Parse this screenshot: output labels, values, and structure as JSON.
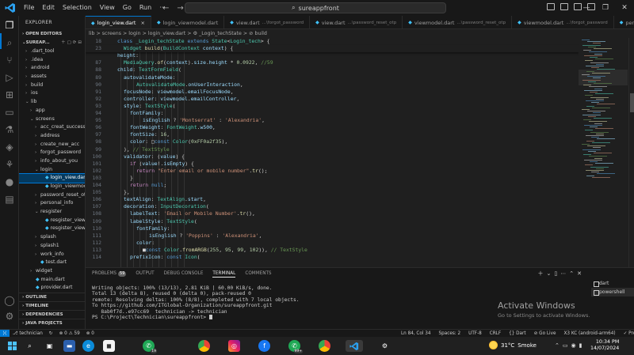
{
  "titlebar": {
    "menu": [
      "File",
      "Edit",
      "Selection",
      "View",
      "Go",
      "Run",
      "···"
    ],
    "search_text": "sureappfront"
  },
  "sidebar": {
    "title": "EXPLORER",
    "open_editors": "OPEN EDITORS",
    "project": "SUREAP...",
    "tree": [
      {
        "label": ".dart_tool",
        "level": 1,
        "chevron": "›"
      },
      {
        "label": ".idea",
        "level": 1,
        "chevron": "›"
      },
      {
        "label": "android",
        "level": 1,
        "chevron": "›"
      },
      {
        "label": "assets",
        "level": 1,
        "chevron": "›"
      },
      {
        "label": "build",
        "level": 1,
        "chevron": "›"
      },
      {
        "label": "ios",
        "level": 1,
        "chevron": "›"
      },
      {
        "label": "lib",
        "level": 1,
        "chevron": "⌄"
      },
      {
        "label": "app",
        "level": 2,
        "chevron": "›"
      },
      {
        "label": "screens",
        "level": 2,
        "chevron": "⌄"
      },
      {
        "label": "acc_creat_successf...",
        "level": 3,
        "chevron": "›"
      },
      {
        "label": "address",
        "level": 3,
        "chevron": "›"
      },
      {
        "label": "create_new_acc",
        "level": 3,
        "chevron": "›"
      },
      {
        "label": "forgot_password",
        "level": 3,
        "chevron": "›"
      },
      {
        "label": "info_about_you",
        "level": 3,
        "chevron": "›"
      },
      {
        "label": "login",
        "level": 3,
        "chevron": "⌄"
      },
      {
        "label": "login_view.dart",
        "level": 4,
        "chevron": "",
        "dart": true,
        "selected": true
      },
      {
        "label": "login_viewmodel....",
        "level": 4,
        "chevron": "",
        "dart": true
      },
      {
        "label": "password_reset_otp",
        "level": 3,
        "chevron": "›"
      },
      {
        "label": "personal_info",
        "level": 3,
        "chevron": "›"
      },
      {
        "label": "resgister",
        "level": 3,
        "chevron": "⌄"
      },
      {
        "label": "resgister_view.dart",
        "level": 4,
        "chevron": "",
        "dart": true
      },
      {
        "label": "resgister_viewmo...",
        "level": 4,
        "chevron": "",
        "dart": true
      },
      {
        "label": "splash",
        "level": 3,
        "chevron": "›"
      },
      {
        "label": "splash1",
        "level": 3,
        "chevron": "›"
      },
      {
        "label": "work_info",
        "level": 3,
        "chevron": "›"
      },
      {
        "label": "test.dart",
        "level": 3,
        "chevron": "",
        "dart": true
      },
      {
        "label": "widget",
        "level": 2,
        "chevron": "›"
      },
      {
        "label": "main.dart",
        "level": 2,
        "chevron": "",
        "dart": true
      },
      {
        "label": "provider.dart",
        "level": 2,
        "chevron": "",
        "dart": true
      }
    ],
    "outline": "OUTLINE",
    "timeline": "TIMELINE",
    "dependencies": "DEPENDENCIES",
    "java_projects": "JAVA PROJECTS"
  },
  "tabs": [
    {
      "label": "login_view.dart",
      "desc": "",
      "active": true
    },
    {
      "label": "login_viewmodel.dart",
      "desc": ""
    },
    {
      "label": "view.dart",
      "desc": "...\\forgot_password"
    },
    {
      "label": "view.dart",
      "desc": "...\\password_reset_otp"
    },
    {
      "label": "viewmodel.dart",
      "desc": "...\\password_reset_otp"
    },
    {
      "label": "viewmodel.dart",
      "desc": "...\\forgot_password"
    },
    {
      "label": "per",
      "desc": ""
    }
  ],
  "breadcrumb": "lib > screens > login > login_view.dart > ⚙ _Login_techState > ⊘ build",
  "code": {
    "sticky": [
      {
        "n": "18",
        "t": [
          [
            "c-kw",
            "class "
          ],
          [
            "c-ty",
            "_Login_techState "
          ],
          [
            "c-kw",
            "extends "
          ],
          [
            "c-ty",
            "State"
          ],
          [
            "c-pl",
            "<"
          ],
          [
            "c-ty",
            "Login_tech"
          ],
          [
            "c-pl",
            "> {"
          ]
        ]
      },
      {
        "n": "23",
        "t": [
          [
            "c-pl",
            "  "
          ],
          [
            "c-ty",
            "Widget "
          ],
          [
            "c-fn",
            "build"
          ],
          [
            "c-pl",
            "("
          ],
          [
            "c-ty",
            "BuildContext "
          ],
          [
            "c-pr",
            "context"
          ],
          [
            "c-pl",
            ") {"
          ]
        ]
      }
    ],
    "lines": [
      {
        "n": "",
        "i": 24,
        "t": [
          [
            "c-pr",
            "height"
          ],
          [
            "c-pl",
            ":"
          ]
        ]
      },
      {
        "n": "87",
        "i": 26,
        "t": [
          [
            "c-ty",
            "MediaQuery"
          ],
          [
            "c-pl",
            "."
          ],
          [
            "c-fn",
            "of"
          ],
          [
            "c-pl",
            "("
          ],
          [
            "c-pr",
            "context"
          ],
          [
            "c-pl",
            ")."
          ],
          [
            "c-pr",
            "size"
          ],
          [
            "c-pl",
            "."
          ],
          [
            "c-pr",
            "height "
          ],
          [
            "c-pl",
            "* "
          ],
          [
            "c-nm",
            "0.0922"
          ],
          [
            "c-pl",
            ", "
          ],
          [
            "c-cm",
            "//59"
          ]
        ]
      },
      {
        "n": "88",
        "i": 24,
        "t": [
          [
            "c-pr",
            "child"
          ],
          [
            "c-pl",
            ": "
          ],
          [
            "c-ty",
            "TextFormField"
          ],
          [
            "c-pl",
            "("
          ]
        ]
      },
      {
        "n": "89",
        "i": 26,
        "t": [
          [
            "c-pr",
            "autovalidateMode"
          ],
          [
            "c-pl",
            ":"
          ]
        ]
      },
      {
        "n": "90",
        "i": 30,
        "t": [
          [
            "c-ty",
            "AutovalidateMode"
          ],
          [
            "c-pl",
            "."
          ],
          [
            "c-pr",
            "onUserInteraction"
          ],
          [
            "c-pl",
            ","
          ]
        ]
      },
      {
        "n": "91",
        "i": 26,
        "t": [
          [
            "c-pr",
            "focusNode"
          ],
          [
            "c-pl",
            ": "
          ],
          [
            "c-pr",
            "viewmodel"
          ],
          [
            "c-pl",
            "."
          ],
          [
            "c-pr",
            "emailFocusNode"
          ],
          [
            "c-pl",
            ","
          ]
        ]
      },
      {
        "n": "92",
        "i": 26,
        "t": [
          [
            "c-pr",
            "controller"
          ],
          [
            "c-pl",
            ": "
          ],
          [
            "c-pr",
            "viewmodel"
          ],
          [
            "c-pl",
            "."
          ],
          [
            "c-pr",
            "emailController"
          ],
          [
            "c-pl",
            ","
          ]
        ]
      },
      {
        "n": "93",
        "i": 26,
        "t": [
          [
            "c-pr",
            "style"
          ],
          [
            "c-pl",
            ": "
          ],
          [
            "c-ty",
            "TextStyle"
          ],
          [
            "c-pl",
            "("
          ]
        ]
      },
      {
        "n": "94",
        "i": 28,
        "t": [
          [
            "c-pr",
            "fontFamily"
          ],
          [
            "c-pl",
            ":"
          ]
        ]
      },
      {
        "n": "95",
        "i": 32,
        "t": [
          [
            "c-pr",
            "isEnglish "
          ],
          [
            "c-pl",
            "? "
          ],
          [
            "c-st",
            "'Montserrat' "
          ],
          [
            "c-pl",
            ": "
          ],
          [
            "c-st",
            "'Alexandria'"
          ],
          [
            "c-pl",
            ","
          ]
        ]
      },
      {
        "n": "96",
        "i": 28,
        "t": [
          [
            "c-pr",
            "fontWeight"
          ],
          [
            "c-pl",
            ": "
          ],
          [
            "c-ty",
            "FontWeight"
          ],
          [
            "c-pl",
            "."
          ],
          [
            "c-pr",
            "w500"
          ],
          [
            "c-pl",
            ","
          ]
        ]
      },
      {
        "n": "97",
        "i": 28,
        "t": [
          [
            "c-pr",
            "fontSize"
          ],
          [
            "c-pl",
            ": "
          ],
          [
            "c-nm",
            "16"
          ],
          [
            "c-pl",
            ","
          ]
        ]
      },
      {
        "n": "98",
        "i": 28,
        "t": [
          [
            "c-pr",
            "color"
          ],
          [
            "c-pl",
            ": □"
          ],
          [
            "c-kw",
            "const "
          ],
          [
            "c-ty",
            "Color"
          ],
          [
            "c-pl",
            "("
          ],
          [
            "c-nm",
            "0xFF0a2f35"
          ],
          [
            "c-pl",
            "),"
          ]
        ]
      },
      {
        "n": "99",
        "i": 26,
        "t": [
          [
            "c-pl",
            "), "
          ],
          [
            "c-cm",
            "// TextStyle"
          ]
        ]
      },
      {
        "n": "100",
        "i": 26,
        "t": [
          [
            "c-pr",
            "validator"
          ],
          [
            "c-pl",
            ": ("
          ],
          [
            "c-pr",
            "value"
          ],
          [
            "c-pl",
            ") {"
          ]
        ]
      },
      {
        "n": "101",
        "i": 28,
        "t": [
          [
            "c-ctl",
            "if "
          ],
          [
            "c-pl",
            "("
          ],
          [
            "c-pr",
            "value"
          ],
          [
            "c-pl",
            "!."
          ],
          [
            "c-pr",
            "isEmpty"
          ],
          [
            "c-pl",
            ") {"
          ]
        ]
      },
      {
        "n": "102",
        "i": 30,
        "t": [
          [
            "c-ctl",
            "return "
          ],
          [
            "c-st",
            "\"Enter email or mobile number\""
          ],
          [
            "c-pl",
            "."
          ],
          [
            "c-fn",
            "tr"
          ],
          [
            "c-pl",
            "();"
          ]
        ]
      },
      {
        "n": "103",
        "i": 28,
        "t": [
          [
            "c-pl",
            "}"
          ]
        ]
      },
      {
        "n": "104",
        "i": 28,
        "t": [
          [
            "c-ctl",
            "return "
          ],
          [
            "c-kw",
            "null"
          ],
          [
            "c-pl",
            ";"
          ]
        ]
      },
      {
        "n": "105",
        "i": 26,
        "t": [
          [
            "c-pl",
            "},"
          ]
        ]
      },
      {
        "n": "106",
        "i": 26,
        "t": [
          [
            "c-pr",
            "textAlign"
          ],
          [
            "c-pl",
            ": "
          ],
          [
            "c-ty",
            "TextAlign"
          ],
          [
            "c-pl",
            "."
          ],
          [
            "c-pr",
            "start"
          ],
          [
            "c-pl",
            ","
          ]
        ]
      },
      {
        "n": "107",
        "i": 26,
        "t": [
          [
            "c-pr",
            "decoration"
          ],
          [
            "c-pl",
            ": "
          ],
          [
            "c-ty",
            "InputDecoration"
          ],
          [
            "c-pl",
            "("
          ]
        ]
      },
      {
        "n": "108",
        "i": 28,
        "t": [
          [
            "c-pr",
            "labelText"
          ],
          [
            "c-pl",
            ": "
          ],
          [
            "c-st",
            "'Email or Mobile Number'"
          ],
          [
            "c-pl",
            "."
          ],
          [
            "c-fn",
            "tr"
          ],
          [
            "c-pl",
            "(),"
          ]
        ]
      },
      {
        "n": "109",
        "i": 28,
        "t": [
          [
            "c-pr",
            "labelStyle"
          ],
          [
            "c-pl",
            ": "
          ],
          [
            "c-ty",
            "TextStyle"
          ],
          [
            "c-pl",
            "("
          ]
        ]
      },
      {
        "n": "110",
        "i": 30,
        "t": [
          [
            "c-pr",
            "fontFamily"
          ],
          [
            "c-pl",
            ":"
          ]
        ]
      },
      {
        "n": "111",
        "i": 34,
        "t": [
          [
            "c-pr",
            "isEnglish "
          ],
          [
            "c-pl",
            "? "
          ],
          [
            "c-st",
            "'Poppins' "
          ],
          [
            "c-pl",
            ": "
          ],
          [
            "c-st",
            "'Alexandria'"
          ],
          [
            "c-pl",
            ","
          ]
        ]
      },
      {
        "n": "112",
        "i": 30,
        "t": [
          [
            "c-pr",
            "color"
          ],
          [
            "c-pl",
            ":"
          ]
        ]
      },
      {
        "n": "113",
        "i": 32,
        "t": [
          [
            "c-pl",
            "■"
          ],
          [
            "c-kw",
            "const "
          ],
          [
            "c-ty",
            "Color"
          ],
          [
            "c-pl",
            "."
          ],
          [
            "c-fn",
            "fromARGB"
          ],
          [
            "c-pl",
            "("
          ],
          [
            "c-nm",
            "255"
          ],
          [
            "c-pl",
            ", "
          ],
          [
            "c-nm",
            "95"
          ],
          [
            "c-pl",
            ", "
          ],
          [
            "c-nm",
            "99"
          ],
          [
            "c-pl",
            ", "
          ],
          [
            "c-nm",
            "102"
          ],
          [
            "c-pl",
            ")), "
          ],
          [
            "c-cm",
            "// TextStyle"
          ]
        ]
      },
      {
        "n": "114",
        "i": 28,
        "t": [
          [
            "c-pr",
            "prefixIcon"
          ],
          [
            "c-pl",
            ": "
          ],
          [
            "c-kw",
            "const "
          ],
          [
            "c-ty",
            "Icon"
          ],
          [
            "c-pl",
            "("
          ]
        ]
      }
    ]
  },
  "panel": {
    "tabs": [
      {
        "label": "PROBLEMS",
        "badge": "59"
      },
      {
        "label": "OUTPUT",
        "badge": ""
      },
      {
        "label": "DEBUG CONSOLE",
        "badge": ""
      },
      {
        "label": "TERMINAL",
        "badge": "",
        "active": true
      },
      {
        "label": "COMMENTS",
        "badge": ""
      }
    ],
    "terminal_lines": [
      "Writing objects: 100% (13/13), 2.81 KiB | 60.00 KiB/s, done.",
      "Total 13 (delta 8), reused 0 (delta 0), pack-reused 0",
      "remote: Resolving deltas: 100% (8/8), completed with 7 local objects.",
      "To https://github.com/ITGlobal-Organization/sureappfront.git",
      "   8ab0f7d..e97cc69  technician -> technician",
      "PS C:\\Project\\Technician\\sureappfront> "
    ],
    "terminals": [
      {
        "label": "dart",
        "active": false
      },
      {
        "label": "powershell",
        "active": true
      }
    ]
  },
  "watermark": {
    "title": "Activate Windows",
    "subtitle": "Go to Settings to activate Windows."
  },
  "statusbar": {
    "left": [
      "⎇ technician",
      "↻",
      "⊗ 0 ⚠ 59",
      "⊗ 0"
    ],
    "right": [
      "Ln 84, Col 34",
      "Spaces: 2",
      "UTF-8",
      "CRLF",
      "{} Dart",
      "⊘ Go Live",
      "X3 KC (android-arm64)",
      "✓ Prettier",
      "🔔"
    ]
  },
  "taskbar": {
    "weather_temp": "31°C",
    "weather_text": "Smoke",
    "time": "10:34 PM",
    "date": "14/07/2024",
    "badges": {
      "whatsapp": "19",
      "chat": "99+"
    }
  }
}
